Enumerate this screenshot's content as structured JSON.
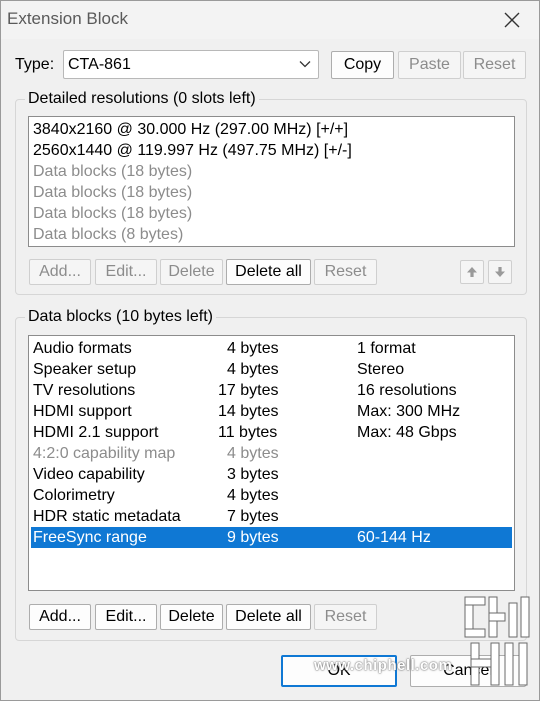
{
  "window": {
    "title": "Extension Block"
  },
  "type_row": {
    "label": "Type:",
    "value": "CTA-861",
    "copy": "Copy",
    "paste": "Paste",
    "reset": "Reset"
  },
  "detailed": {
    "title": "Detailed resolutions (0 slots left)",
    "items": [
      {
        "text": "3840x2160 @ 30.000 Hz (297.00 MHz) [+/+]",
        "enabled": true
      },
      {
        "text": "2560x1440 @ 119.997 Hz (497.75 MHz) [+/-]",
        "enabled": true
      },
      {
        "text": "Data blocks (18 bytes)",
        "enabled": false
      },
      {
        "text": "Data blocks (18 bytes)",
        "enabled": false
      },
      {
        "text": "Data blocks (18 bytes)",
        "enabled": false
      },
      {
        "text": "Data blocks (8 bytes)",
        "enabled": false
      }
    ],
    "buttons": {
      "add": "Add...",
      "edit": "Edit...",
      "delete": "Delete",
      "delete_all": "Delete all",
      "reset": "Reset"
    }
  },
  "datablocks": {
    "title": "Data blocks (10 bytes left)",
    "rows": [
      {
        "name": "Audio formats",
        "size": "4 bytes",
        "info": "1 format",
        "enabled": true
      },
      {
        "name": "Speaker setup",
        "size": "4 bytes",
        "info": "Stereo",
        "enabled": true
      },
      {
        "name": "TV resolutions",
        "size": "17 bytes",
        "info": "16 resolutions",
        "enabled": true
      },
      {
        "name": "HDMI support",
        "size": "14 bytes",
        "info": "Max: 300 MHz",
        "enabled": true
      },
      {
        "name": "HDMI 2.1 support",
        "size": "11 bytes",
        "info": "Max: 48 Gbps",
        "enabled": true
      },
      {
        "name": "4:2:0 capability map",
        "size": "4 bytes",
        "info": "",
        "enabled": false
      },
      {
        "name": "Video capability",
        "size": "3 bytes",
        "info": "",
        "enabled": true
      },
      {
        "name": "Colorimetry",
        "size": "4 bytes",
        "info": "",
        "enabled": true
      },
      {
        "name": "HDR static metadata",
        "size": "7 bytes",
        "info": "",
        "enabled": true
      },
      {
        "name": "FreeSync range",
        "size": "9 bytes",
        "info": "60-144 Hz",
        "enabled": true,
        "selected": true
      }
    ],
    "buttons": {
      "add": "Add...",
      "edit": "Edit...",
      "delete": "Delete",
      "delete_all": "Delete all",
      "reset": "Reset"
    }
  },
  "footer": {
    "ok": "OK",
    "cancel": "Cancel"
  },
  "watermark": {
    "site": "www.chiphell.com",
    "logo_text": "chip hell"
  },
  "colors": {
    "selection": "#0f78d4",
    "disabled_text": "#8c8c8c"
  }
}
